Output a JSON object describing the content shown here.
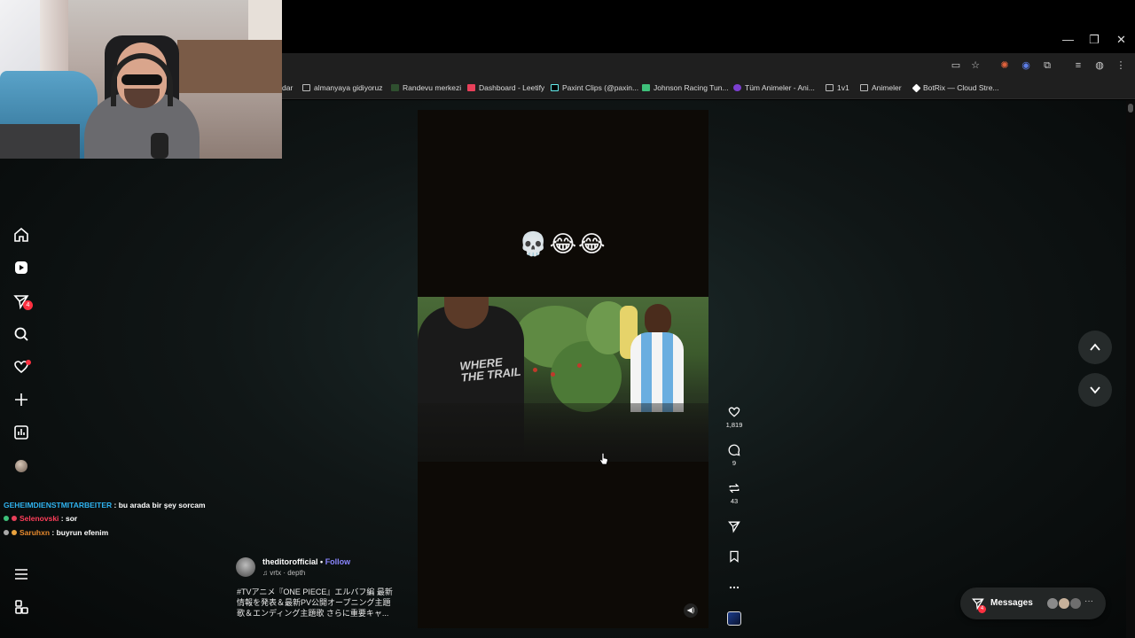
{
  "browser": {
    "window_controls": {
      "minimize": "—",
      "restore": "❐",
      "close": "✕"
    },
    "bookmarks": [
      {
        "label": "dar",
        "icon": "none"
      },
      {
        "label": "almanyaya gidiyoruz",
        "icon": "folder-icon"
      },
      {
        "label": "Randevu merkezi",
        "icon": "site-icon"
      },
      {
        "label": "Dashboard - Leetify",
        "icon": "leetify-icon"
      },
      {
        "label": "Paxint Clips (@paxin...",
        "icon": "tiktok-icon"
      },
      {
        "label": "Johnson Racing Tun...",
        "icon": "site-icon"
      },
      {
        "label": "Tüm Animeler - Ani...",
        "icon": "site-icon"
      },
      {
        "label": "1v1",
        "icon": "folder-icon"
      },
      {
        "label": "Animeler",
        "icon": "folder-icon"
      },
      {
        "label": "BotRix — Cloud Stre...",
        "icon": "botrix-icon"
      }
    ]
  },
  "sidebar": {
    "items": [
      {
        "name": "home",
        "icon": "home-icon"
      },
      {
        "name": "reels",
        "icon": "reels-icon"
      },
      {
        "name": "messages",
        "icon": "send-icon",
        "badge": "4"
      },
      {
        "name": "search",
        "icon": "search-icon"
      },
      {
        "name": "notifications",
        "icon": "heart-icon",
        "dot": true
      },
      {
        "name": "create",
        "icon": "plus-icon"
      },
      {
        "name": "dashboard",
        "icon": "chart-icon"
      },
      {
        "name": "profile",
        "icon": "avatar"
      },
      {
        "name": "more",
        "icon": "menu-icon"
      },
      {
        "name": "also-from-meta",
        "icon": "grid-icon"
      }
    ]
  },
  "chat": [
    {
      "user": "GEHEIMDIENSTMITARBEITER",
      "message": "bu arada bir şey sorcam"
    },
    {
      "user": "Selenovski",
      "message": "sor"
    },
    {
      "user": "Saruhxn",
      "message": "buyrun efenim"
    }
  ],
  "reel": {
    "overlay_text": "💀😂😂",
    "clip_shirt_text": "WHERE THE TRAIL",
    "author": "theditorofficial",
    "separator": "•",
    "follow_label": "Follow",
    "audio": "vrtx · depth",
    "caption_lines": [
      "#TVアニメ『ONE PIECE』エルバフ編 最新",
      "情報を発表＆最新PV公開オープニング主題",
      "歌＆エンディング主題歌 さらに重要キャ..."
    ],
    "likes": "1,819",
    "comments": "9",
    "reposts": "43"
  },
  "messages_pill": {
    "label": "Messages",
    "badge": "4",
    "more": "···"
  },
  "colors": {
    "accent_follow": "#8a86ff",
    "badge_red": "#ff3040",
    "chat_user1": "#2fb3f0",
    "chat_user2": "#ff3e5a",
    "chat_user3": "#e88a2e"
  }
}
